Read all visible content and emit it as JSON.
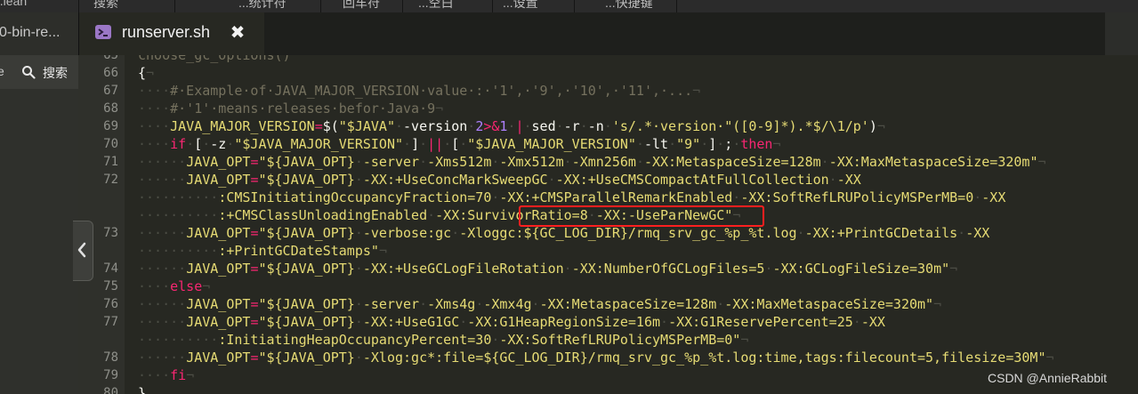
{
  "top_menu": {
    "segments": [
      "...lean",
      "搜索",
      "...统计符",
      "回车符",
      "...空白",
      "...设置",
      "...快捷键"
    ]
  },
  "tabs": [
    {
      "label": "0-bin-re...",
      "active": false
    },
    {
      "label": "runserver.sh",
      "active": true,
      "icon": "terminal-script-icon",
      "close": "✖"
    }
  ],
  "side_panel": {
    "collapse_label": "e",
    "search_label": "搜索"
  },
  "editor": {
    "lines": [
      {
        "n": "65",
        "segs": [
          [
            "cm",
            "choose_gc_options()"
          ]
        ]
      },
      {
        "n": "66",
        "segs": [
          [
            "br",
            "{"
          ],
          [
            "ws",
            "¬"
          ]
        ]
      },
      {
        "n": "67",
        "segs": [
          [
            "ws",
            "····"
          ],
          [
            "cm",
            "#·Example·of·JAVA_MAJOR_VERSION·value·:·'1',·'9',·'10',·'11',·..."
          ],
          [
            "ws",
            "¬"
          ]
        ]
      },
      {
        "n": "68",
        "segs": [
          [
            "ws",
            "····"
          ],
          [
            "cm",
            "#·'1'·means·releases·befor·Java·9"
          ],
          [
            "ws",
            "¬"
          ]
        ]
      },
      {
        "n": "69",
        "segs": [
          [
            "ws",
            "····"
          ],
          [
            "vr",
            "JAVA_MAJOR_VERSION"
          ],
          [
            "op",
            "="
          ],
          [
            "tx",
            "$("
          ],
          [
            "st",
            "\"$JAVA\""
          ],
          [
            "ws",
            "·"
          ],
          [
            "tx",
            "-version"
          ],
          [
            "ws",
            "·"
          ],
          [
            "nm",
            "2"
          ],
          [
            "op",
            ">&"
          ],
          [
            "nm",
            "1"
          ],
          [
            "ws",
            "·"
          ],
          [
            "op",
            "|"
          ],
          [
            "ws",
            "·"
          ],
          [
            "tx",
            "sed"
          ],
          [
            "ws",
            "·"
          ],
          [
            "tx",
            "-r"
          ],
          [
            "ws",
            "·"
          ],
          [
            "tx",
            "-n"
          ],
          [
            "ws",
            "·"
          ],
          [
            "st",
            "'s/.*·version·\"([0-9]*).*$/\\1/p'"
          ],
          [
            "tx",
            ")"
          ],
          [
            "ws",
            "¬"
          ]
        ]
      },
      {
        "n": "70",
        "segs": [
          [
            "ws",
            "····"
          ],
          [
            "kw",
            "if"
          ],
          [
            "ws",
            "·"
          ],
          [
            "tx",
            "["
          ],
          [
            "ws",
            "·"
          ],
          [
            "tx",
            "-z"
          ],
          [
            "ws",
            "·"
          ],
          [
            "st",
            "\"$JAVA_MAJOR_VERSION\""
          ],
          [
            "ws",
            "·"
          ],
          [
            "tx",
            "]"
          ],
          [
            "ws",
            "·"
          ],
          [
            "op",
            "||"
          ],
          [
            "ws",
            "·"
          ],
          [
            "tx",
            "["
          ],
          [
            "ws",
            "·"
          ],
          [
            "st",
            "\"$JAVA_MAJOR_VERSION\""
          ],
          [
            "ws",
            "·"
          ],
          [
            "tx",
            "-lt"
          ],
          [
            "ws",
            "·"
          ],
          [
            "st",
            "\"9\""
          ],
          [
            "ws",
            "·"
          ],
          [
            "tx",
            "]"
          ],
          [
            "ws",
            "·"
          ],
          [
            "tx",
            ";"
          ],
          [
            "ws",
            "·"
          ],
          [
            "kw",
            "then"
          ],
          [
            "ws",
            "¬"
          ]
        ]
      },
      {
        "n": "71",
        "segs": [
          [
            "ws",
            "······"
          ],
          [
            "vr",
            "JAVA_OPT"
          ],
          [
            "op",
            "="
          ],
          [
            "st",
            "\"${JAVA_OPT}"
          ],
          [
            "ws",
            "·"
          ],
          [
            "st",
            "-server"
          ],
          [
            "ws",
            "·"
          ],
          [
            "st",
            "-Xms512m"
          ],
          [
            "ws",
            "·"
          ],
          [
            "st",
            "-Xmx512m"
          ],
          [
            "ws",
            "·"
          ],
          [
            "st",
            "-Xmn256m"
          ],
          [
            "ws",
            "·"
          ],
          [
            "st",
            "-XX:MetaspaceSize=128m"
          ],
          [
            "ws",
            "·"
          ],
          [
            "st",
            "-XX:MaxMetaspaceSize=320m\""
          ],
          [
            "ws",
            "¬"
          ]
        ]
      },
      {
        "n": "72",
        "segs": [
          [
            "ws",
            "······"
          ],
          [
            "vr",
            "JAVA_OPT"
          ],
          [
            "op",
            "="
          ],
          [
            "st",
            "\"${JAVA_OPT}"
          ],
          [
            "ws",
            "·"
          ],
          [
            "st",
            "-XX:+UseConcMarkSweepGC"
          ],
          [
            "ws",
            "·"
          ],
          [
            "st",
            "-XX:+UseCMSCompactAtFullCollection"
          ],
          [
            "ws",
            "·"
          ],
          [
            "st",
            "-XX"
          ]
        ]
      },
      {
        "n": "",
        "segs": [
          [
            "ws",
            "··········"
          ],
          [
            "st",
            ":CMSInitiatingOccupancyFraction=70"
          ],
          [
            "ws",
            "·"
          ],
          [
            "st",
            "-XX:+CMSParallelRemarkEnabled"
          ],
          [
            "ws",
            "·"
          ],
          [
            "st",
            "-XX:SoftRefLRUPolicyMSPerMB=0"
          ],
          [
            "ws",
            "·"
          ],
          [
            "st",
            "-XX"
          ]
        ]
      },
      {
        "n": "",
        "segs": [
          [
            "ws",
            "··········"
          ],
          [
            "st",
            ":+CMSClassUnloadingEnabled"
          ],
          [
            "ws",
            "·"
          ],
          [
            "st",
            "-XX:SurvivorRatio=8"
          ],
          [
            "ws",
            "·"
          ],
          [
            "st",
            "-XX:-UseParNewGC\""
          ],
          [
            "ws",
            "¬"
          ]
        ]
      },
      {
        "n": "73",
        "segs": [
          [
            "ws",
            "······"
          ],
          [
            "vr",
            "JAVA_OPT"
          ],
          [
            "op",
            "="
          ],
          [
            "st",
            "\"${JAVA_OPT}"
          ],
          [
            "ws",
            "·"
          ],
          [
            "st",
            "-verbose:gc"
          ],
          [
            "ws",
            "·"
          ],
          [
            "st",
            "-Xloggc:${GC_LOG_DIR}/rmq_srv_gc_%p_%t.log"
          ],
          [
            "ws",
            "·"
          ],
          [
            "st",
            "-XX:+PrintGCDetails"
          ],
          [
            "ws",
            "·"
          ],
          [
            "st",
            "-XX"
          ]
        ]
      },
      {
        "n": "",
        "segs": [
          [
            "ws",
            "··········"
          ],
          [
            "st",
            ":+PrintGCDateStamps\""
          ],
          [
            "ws",
            "¬"
          ]
        ]
      },
      {
        "n": "74",
        "segs": [
          [
            "ws",
            "······"
          ],
          [
            "vr",
            "JAVA_OPT"
          ],
          [
            "op",
            "="
          ],
          [
            "st",
            "\"${JAVA_OPT}"
          ],
          [
            "ws",
            "·"
          ],
          [
            "st",
            "-XX:+UseGCLogFileRotation"
          ],
          [
            "ws",
            "·"
          ],
          [
            "st",
            "-XX:NumberOfGCLogFiles=5"
          ],
          [
            "ws",
            "·"
          ],
          [
            "st",
            "-XX:GCLogFileSize=30m\""
          ],
          [
            "ws",
            "¬"
          ]
        ]
      },
      {
        "n": "75",
        "segs": [
          [
            "ws",
            "····"
          ],
          [
            "kw",
            "else"
          ],
          [
            "ws",
            "¬"
          ]
        ]
      },
      {
        "n": "76",
        "segs": [
          [
            "ws",
            "······"
          ],
          [
            "vr",
            "JAVA_OPT"
          ],
          [
            "op",
            "="
          ],
          [
            "st",
            "\"${JAVA_OPT}"
          ],
          [
            "ws",
            "·"
          ],
          [
            "st",
            "-server"
          ],
          [
            "ws",
            "·"
          ],
          [
            "st",
            "-Xms4g"
          ],
          [
            "ws",
            "·"
          ],
          [
            "st",
            "-Xmx4g"
          ],
          [
            "ws",
            "·"
          ],
          [
            "st",
            "-XX:MetaspaceSize=128m"
          ],
          [
            "ws",
            "·"
          ],
          [
            "st",
            "-XX:MaxMetaspaceSize=320m\""
          ],
          [
            "ws",
            "¬"
          ]
        ]
      },
      {
        "n": "77",
        "segs": [
          [
            "ws",
            "······"
          ],
          [
            "vr",
            "JAVA_OPT"
          ],
          [
            "op",
            "="
          ],
          [
            "st",
            "\"${JAVA_OPT}"
          ],
          [
            "ws",
            "·"
          ],
          [
            "st",
            "-XX:+UseG1GC"
          ],
          [
            "ws",
            "·"
          ],
          [
            "st",
            "-XX:G1HeapRegionSize=16m"
          ],
          [
            "ws",
            "·"
          ],
          [
            "st",
            "-XX:G1ReservePercent=25"
          ],
          [
            "ws",
            "·"
          ],
          [
            "st",
            "-XX"
          ]
        ]
      },
      {
        "n": "",
        "segs": [
          [
            "ws",
            "··········"
          ],
          [
            "st",
            ":InitiatingHeapOccupancyPercent=30"
          ],
          [
            "ws",
            "·"
          ],
          [
            "st",
            "-XX:SoftRefLRUPolicyMSPerMB=0\""
          ],
          [
            "ws",
            "¬"
          ]
        ]
      },
      {
        "n": "78",
        "segs": [
          [
            "ws",
            "······"
          ],
          [
            "vr",
            "JAVA_OPT"
          ],
          [
            "op",
            "="
          ],
          [
            "st",
            "\"${JAVA_OPT}"
          ],
          [
            "ws",
            "·"
          ],
          [
            "st",
            "-Xlog:gc*:file=${GC_LOG_DIR}/rmq_srv_gc_%p_%t.log:time,tags:filecount=5,filesize=30M\""
          ],
          [
            "ws",
            "¬"
          ]
        ]
      },
      {
        "n": "79",
        "segs": [
          [
            "ws",
            "····"
          ],
          [
            "kw",
            "fi"
          ],
          [
            "ws",
            "¬"
          ]
        ]
      },
      {
        "n": "80",
        "segs": [
          [
            "br",
            "}"
          ]
        ]
      }
    ]
  },
  "watermark": "CSDN @AnnieRabbit",
  "colors": {
    "background": "#272822",
    "gutter": "#2f302b",
    "keyword": "#f92672",
    "string": "#e6db74",
    "comment": "#75715e",
    "highlight_box": "#ff1f1f",
    "tab_icon": "#9b77c6"
  }
}
